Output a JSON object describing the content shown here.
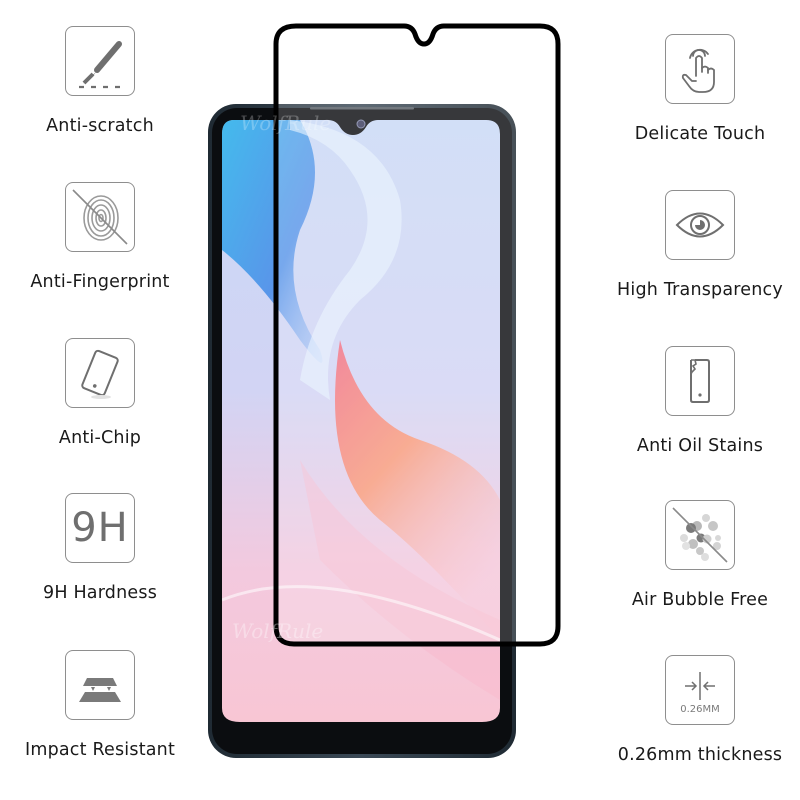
{
  "product": {
    "description": "Tempered glass screen protector shown over a smartphone",
    "watermark": "WolfRule"
  },
  "features_left": [
    {
      "icon": "scalpel-scratch-icon",
      "label": "Anti-scratch"
    },
    {
      "icon": "fingerprint-crossed-icon",
      "label": "Anti-Fingerprint"
    },
    {
      "icon": "tilted-phone-icon",
      "label": "Anti-Chip"
    },
    {
      "icon": "nine-h-icon",
      "label": "9H Hardness",
      "icon_text": "9H"
    },
    {
      "icon": "layered-plates-icon",
      "label": "Impact Resistant"
    }
  ],
  "features_right": [
    {
      "icon": "touch-hand-icon",
      "label": "Delicate Touch"
    },
    {
      "icon": "eye-icon",
      "label": "High Transparency"
    },
    {
      "icon": "chipped-phone-icon",
      "label": "Anti Oil Stains"
    },
    {
      "icon": "bubbles-crossed-icon",
      "label": "Air Bubble Free"
    },
    {
      "icon": "thickness-arrows-icon",
      "label": "0.26mm thickness",
      "icon_text": "0.26MM"
    }
  ],
  "colors": {
    "icon_stroke": "#8e8e8e",
    "icon_fill": "#6f6f6f",
    "label_text": "#1a1a1a",
    "protector_border": "#000000",
    "phone_frame": "#2e3a44"
  }
}
